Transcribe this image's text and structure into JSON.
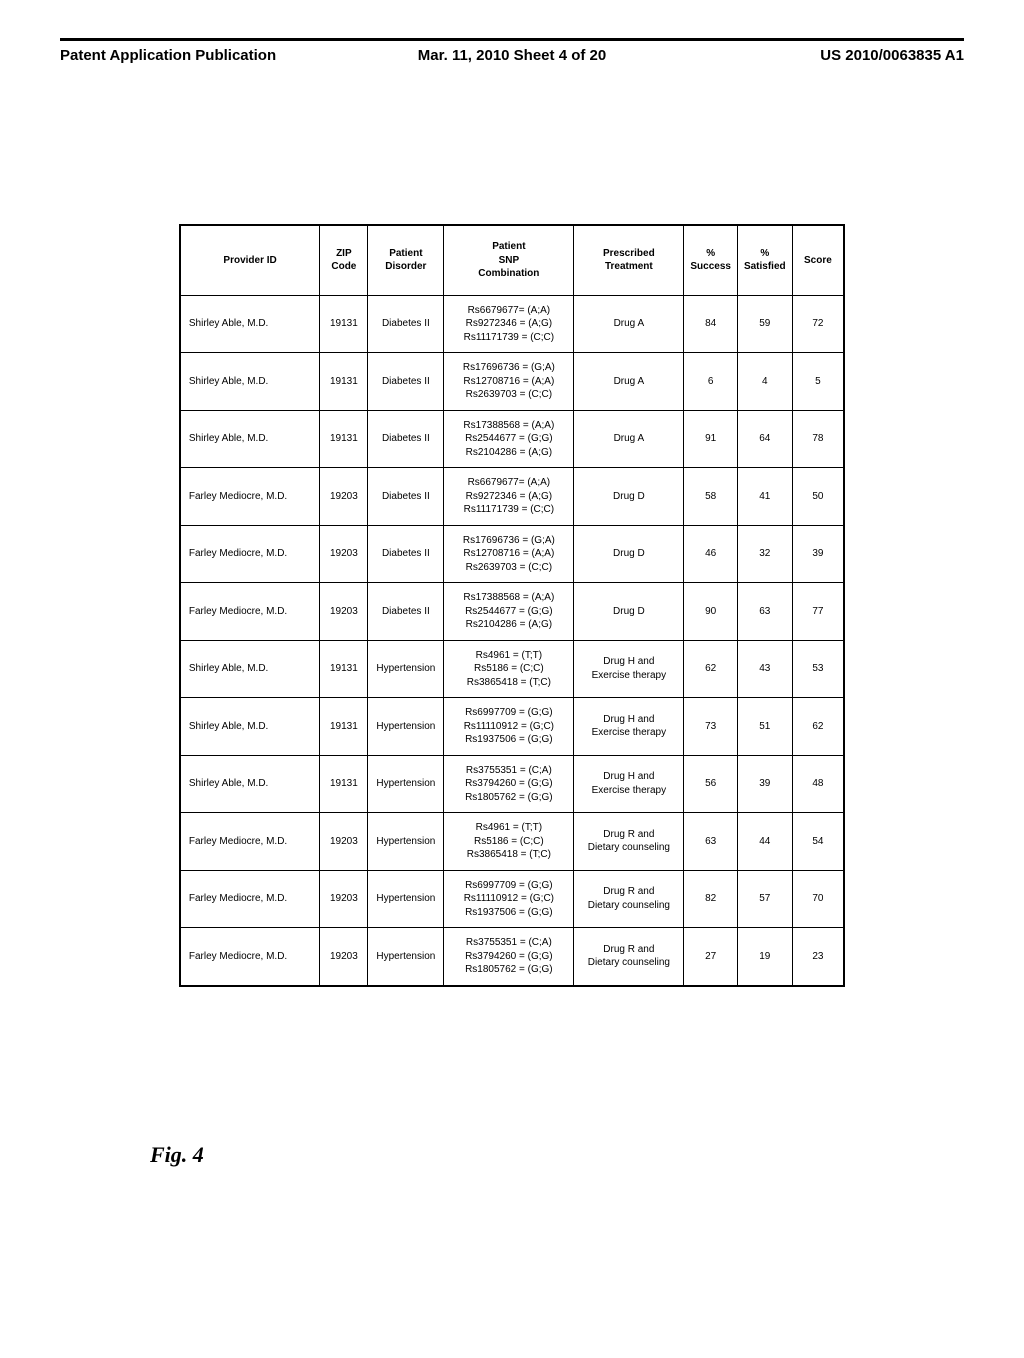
{
  "header": {
    "left": "Patent Application Publication",
    "center": "Mar. 11, 2010  Sheet 4 of 20",
    "right": "US 2010/0063835 A1"
  },
  "figure_label": "Fig. 4",
  "table": {
    "columns": [
      "Provider ID",
      "ZIP Code",
      "Patient Disorder",
      "Patient SNP Combination",
      "Prescribed Treatment",
      "% Success",
      "% Satisfied",
      "Score"
    ],
    "rows": [
      {
        "provider": "Shirley Able, M.D.",
        "zip": "19131",
        "disorder": "Diabetes II",
        "snp": [
          "Rs6679677= (A;A)",
          "Rs9272346 = (A;G)",
          "Rs11171739 = (C;C)"
        ],
        "treatment": [
          "Drug A"
        ],
        "success": "84",
        "satisfied": "59",
        "score": "72"
      },
      {
        "provider": "Shirley Able, M.D.",
        "zip": "19131",
        "disorder": "Diabetes II",
        "snp": [
          "Rs17696736 = (G;A)",
          "Rs12708716 = (A;A)",
          "Rs2639703 = (C;C)"
        ],
        "treatment": [
          "Drug A"
        ],
        "success": "6",
        "satisfied": "4",
        "score": "5"
      },
      {
        "provider": "Shirley Able, M.D.",
        "zip": "19131",
        "disorder": "Diabetes II",
        "snp": [
          "Rs17388568 = (A;A)",
          "Rs2544677 = (G;G)",
          "Rs2104286 = (A;G)"
        ],
        "treatment": [
          "Drug A"
        ],
        "success": "91",
        "satisfied": "64",
        "score": "78"
      },
      {
        "provider": "Farley Mediocre, M.D.",
        "zip": "19203",
        "disorder": "Diabetes II",
        "snp": [
          "Rs6679677= (A;A)",
          "Rs9272346 = (A;G)",
          "Rs11171739 = (C;C)"
        ],
        "treatment": [
          "Drug D"
        ],
        "success": "58",
        "satisfied": "41",
        "score": "50"
      },
      {
        "provider": "Farley Mediocre, M.D.",
        "zip": "19203",
        "disorder": "Diabetes II",
        "snp": [
          "Rs17696736 = (G;A)",
          "Rs12708716 = (A;A)",
          "Rs2639703 = (C;C)"
        ],
        "treatment": [
          "Drug D"
        ],
        "success": "46",
        "satisfied": "32",
        "score": "39"
      },
      {
        "provider": "Farley Mediocre, M.D.",
        "zip": "19203",
        "disorder": "Diabetes II",
        "snp": [
          "Rs17388568 = (A;A)",
          "Rs2544677 = (G;G)",
          "Rs2104286 = (A;G)"
        ],
        "treatment": [
          "Drug D"
        ],
        "success": "90",
        "satisfied": "63",
        "score": "77"
      },
      {
        "provider": "Shirley Able, M.D.",
        "zip": "19131",
        "disorder": "Hypertension",
        "snp": [
          "Rs4961 = (T;T)",
          "Rs5186 = (C;C)",
          "Rs3865418 = (T;C)"
        ],
        "treatment": [
          "Drug H and",
          "Exercise therapy"
        ],
        "success": "62",
        "satisfied": "43",
        "score": "53"
      },
      {
        "provider": "Shirley Able, M.D.",
        "zip": "19131",
        "disorder": "Hypertension",
        "snp": [
          "Rs6997709 = (G;G)",
          "Rs11110912 = (G;C)",
          "Rs1937506 = (G;G)"
        ],
        "treatment": [
          "Drug H and",
          "Exercise therapy"
        ],
        "success": "73",
        "satisfied": "51",
        "score": "62"
      },
      {
        "provider": "Shirley Able, M.D.",
        "zip": "19131",
        "disorder": "Hypertension",
        "snp": [
          "Rs3755351 = (C;A)",
          "Rs3794260 = (G;G)",
          "Rs1805762 = (G;G)"
        ],
        "treatment": [
          "Drug H and",
          "Exercise therapy"
        ],
        "success": "56",
        "satisfied": "39",
        "score": "48"
      },
      {
        "provider": "Farley Mediocre, M.D.",
        "zip": "19203",
        "disorder": "Hypertension",
        "snp": [
          "Rs4961 = (T;T)",
          "Rs5186 = (C;C)",
          "Rs3865418 = (T;C)"
        ],
        "treatment": [
          "Drug R and",
          "Dietary counseling"
        ],
        "success": "63",
        "satisfied": "44",
        "score": "54"
      },
      {
        "provider": "Farley Mediocre, M.D.",
        "zip": "19203",
        "disorder": "Hypertension",
        "snp": [
          "Rs6997709 = (G;G)",
          "Rs11110912 = (G;C)",
          "Rs1937506 = (G;G)"
        ],
        "treatment": [
          "Drug R and",
          "Dietary counseling"
        ],
        "success": "82",
        "satisfied": "57",
        "score": "70"
      },
      {
        "provider": "Farley Mediocre, M.D.",
        "zip": "19203",
        "disorder": "Hypertension",
        "snp": [
          "Rs3755351 = (C;A)",
          "Rs3794260 = (G;G)",
          "Rs1805762 = (G;G)"
        ],
        "treatment": [
          "Drug R and",
          "Dietary counseling"
        ],
        "success": "27",
        "satisfied": "19",
        "score": "23"
      }
    ]
  }
}
